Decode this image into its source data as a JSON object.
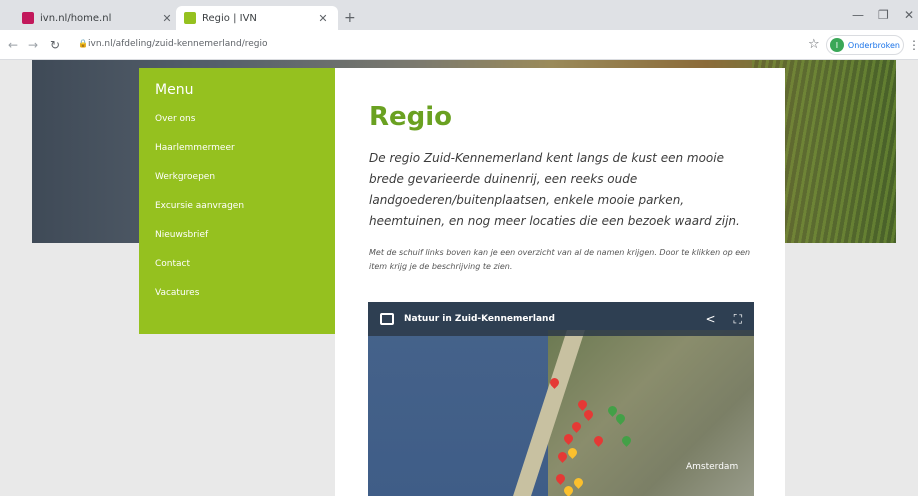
{
  "browser": {
    "tabs": [
      {
        "title": "ivn.nl/home.nl",
        "favicon_color": "#c2185b"
      },
      {
        "title": "Regio | IVN",
        "favicon_color": "#95c11f"
      }
    ],
    "new_tab": "+",
    "url": "ivn.nl/afdeling/zuid-kennemerland/regio",
    "profile_button": "Onderbroken",
    "profile_initial": "I"
  },
  "menu": {
    "title": "Menu",
    "items": [
      "Over ons",
      "Haarlemmermeer",
      "Werkgroepen",
      "Excursie aanvragen",
      "Nieuwsbrief",
      "Contact",
      "Vacatures"
    ]
  },
  "content": {
    "heading": "Regio",
    "lead": "De regio Zuid-Kennemerland kent langs de kust een mooie brede gevarieerde duinenrij, een reeks oude landgoederen/buitenplaatsen, enkele mooie parken, heemtuinen, en nog meer locaties die een bezoek waard zijn.",
    "note": "Met de schuif links boven kan je een overzicht van al de namen krijgen. Door te klikken op een item krijg je de beschrijving te zien."
  },
  "map": {
    "title": "Natuur in Zuid-Kennemerland",
    "city_label": "Amsterdam",
    "pin_red": "#e53935",
    "pin_green": "#43a047",
    "pin_yellow": "#fbc02d"
  }
}
